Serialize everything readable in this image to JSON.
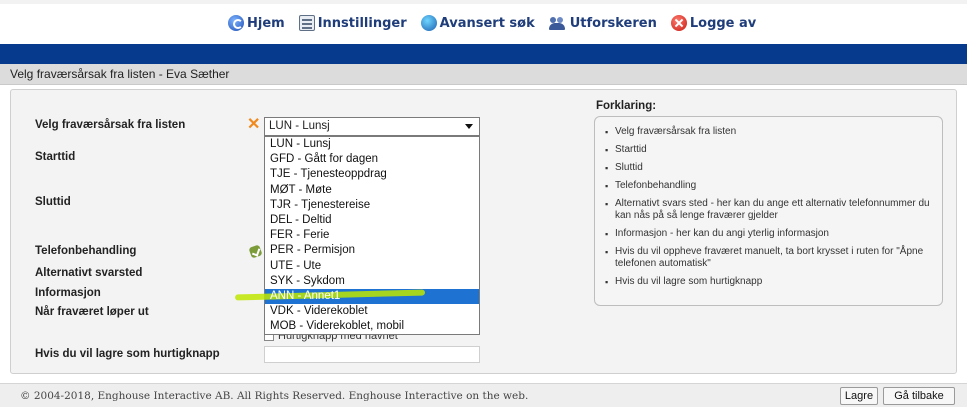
{
  "nav": {
    "items": [
      {
        "label": "Hjem",
        "icon": "home-icon"
      },
      {
        "label": "Innstillinger",
        "icon": "settings-icon"
      },
      {
        "label": "Avansert søk",
        "icon": "globe-search-icon"
      },
      {
        "label": "Utforskeren",
        "icon": "users-icon"
      },
      {
        "label": "Logge av",
        "icon": "logout-icon"
      }
    ]
  },
  "page": {
    "title": "Velg fraværsårsak fra listen - Eva Sæther"
  },
  "form": {
    "reason_label": "Velg fraværsårsak fra listen",
    "start_label": "Starttid",
    "end_label": "Sluttid",
    "phone_label": "Telefonbehandling",
    "alt_answer_label": "Alternativt svarsted",
    "info_label": "Informasjon",
    "expire_label": "Når fraværet løper ut",
    "shortcut_label": "Hvis du vil lagre som hurtigknapp",
    "shortcut_checkbox": "Hurtigknapp med navnet",
    "select": {
      "value": "LUN - Lunsj",
      "options": [
        "LUN - Lunsj",
        "GFD - Gått for dagen",
        "TJE - Tjenesteoppdrag",
        "MØT - Møte",
        "TJR - Tjenestereise",
        "DEL - Deltid",
        "FER - Ferie",
        "PER - Permisjon",
        "UTE - Ute",
        "SYK - Sykdom",
        "ANN - Annet1",
        "VDK - Viderekoblet",
        "MOB - Viderekoblet, mobil"
      ],
      "highlighted": "ANN - Annet1"
    }
  },
  "help": {
    "title": "Forklaring:",
    "items": [
      "Velg fraværsårsak fra listen",
      "Starttid",
      "Sluttid",
      "Telefonbehandling",
      "Alternativt svars sted - her kan du ange ett alternativ telefonnummer du kan nås på så lenge fraværer gjelder",
      "Informasjon - her kan du angi yterlig informasjon",
      "Hvis du vil oppheve fraværet manuelt, ta bort krysset i ruten for \"Åpne telefonen automatisk\"",
      "Hvis du vil lagre som hurtigknapp"
    ]
  },
  "footer": {
    "copyright": "© 2004-2018, Enghouse Interactive AB. All Rights Reserved.   Enghouse Interactive on the web.",
    "save_label": "Lagre",
    "back_label": "Gå tilbake"
  },
  "colors": {
    "header_bar": "#063a8c",
    "selection": "#1e73d2",
    "marker_highlight": "#bee600",
    "required_mark": "#f08a1e"
  }
}
